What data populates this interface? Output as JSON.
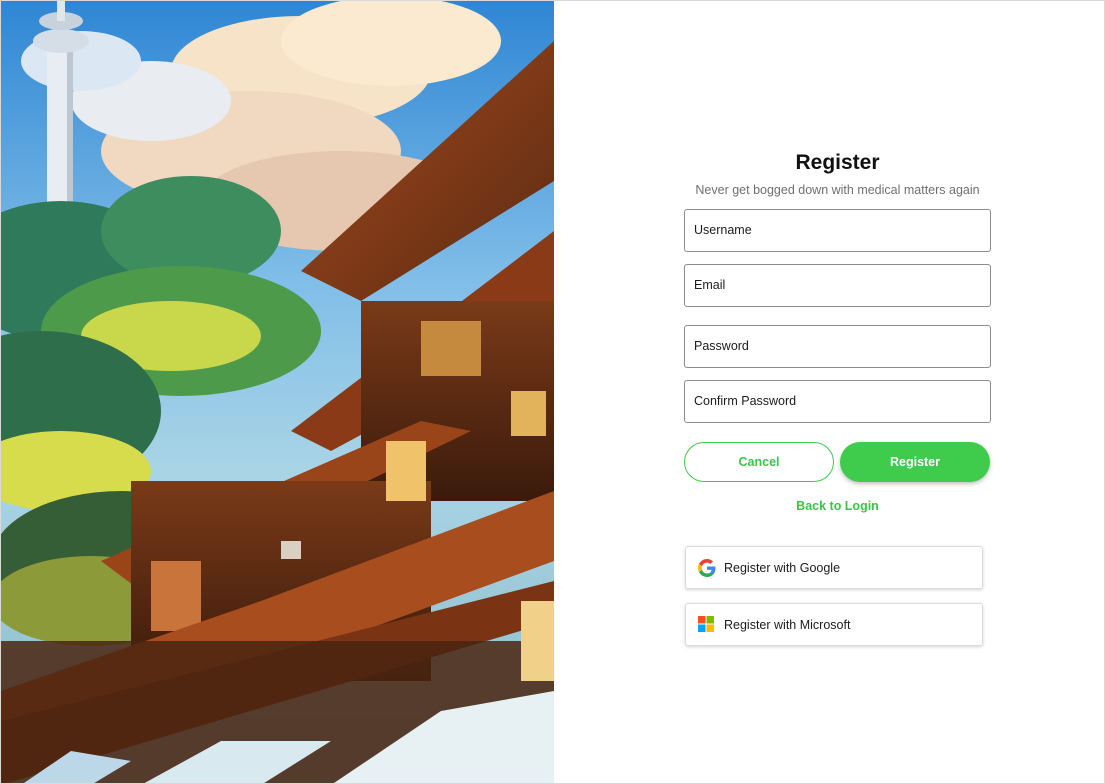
{
  "form": {
    "title": "Register",
    "subtitle": "Never get bogged down with medical matters again",
    "fields": {
      "username": "Username",
      "email": "Email",
      "password": "Password",
      "confirm_password": "Confirm Password"
    },
    "buttons": {
      "cancel": "Cancel",
      "register": "Register"
    },
    "back_link": "Back to Login",
    "social": {
      "google": "Register with Google",
      "microsoft": "Register with Microsoft"
    }
  },
  "colors": {
    "accent_green": "#3fcb4b",
    "microsoft_red": "#f25022",
    "microsoft_green": "#7fba00",
    "microsoft_blue": "#00a4ef",
    "microsoft_yellow": "#ffb900"
  },
  "icons": {
    "google": "google-logo-icon",
    "microsoft": "microsoft-logo-icon"
  }
}
